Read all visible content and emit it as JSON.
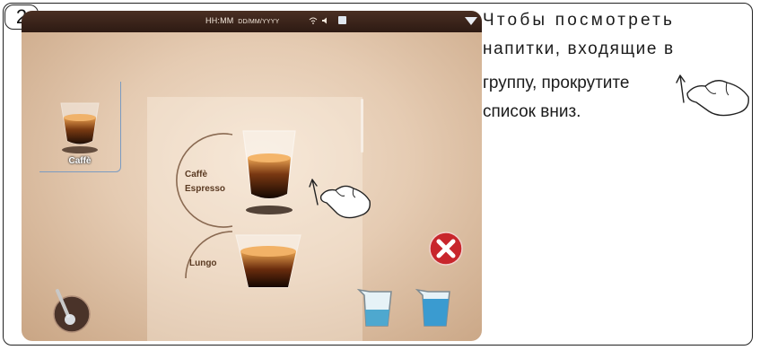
{
  "step": {
    "number": "2"
  },
  "status_bar": {
    "time": "HH:MM",
    "date": "DD/MM/YYYY"
  },
  "drinks_list": {
    "group_label": "Caffè",
    "items": [
      {
        "label_line1": "Caffè",
        "label_line2": "Espresso"
      },
      {
        "label_line1": "Lungo",
        "label_line2": ""
      }
    ]
  },
  "instruction": {
    "line1": "Чтобы посмотреть",
    "line2": "напитки, входящие в",
    "line3": "группу, прокрутите",
    "line4": "список вниз."
  },
  "colors": {
    "cancel_red": "#c8262c",
    "selection_blue": "#7b9bc1",
    "topbar": "#2d1a13"
  }
}
